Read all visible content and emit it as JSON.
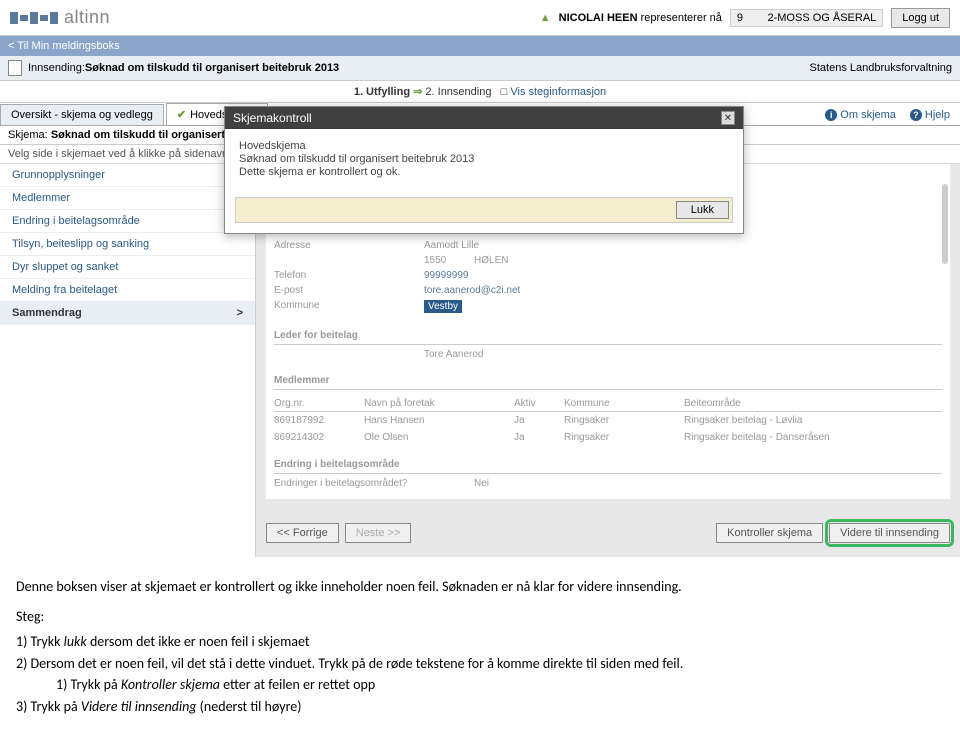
{
  "header": {
    "brand": "altinn",
    "user_name": "NICOLAI HEEN",
    "represents_label": "representerer nå",
    "org_id": "9",
    "org_suffix": "2-MOSS OG ÅSERAL",
    "logout": "Logg ut"
  },
  "breadcrumb": {
    "back": "< Til Min meldingsboks"
  },
  "titlebar": {
    "prefix": "Innsending:",
    "title": "Søknad om tilskudd til organisert beitebruk 2013",
    "owner": "Statens Landbruksforvaltning"
  },
  "steps": {
    "s1": "1. Utfylling",
    "s2": "2. Innsending",
    "info": "Vis steginformasjon",
    "sq": "□"
  },
  "tabs": {
    "overview": "Oversikt - skjema og vedlegg",
    "main": "Hovedskjema"
  },
  "skjema_title": {
    "label": "Skjema:",
    "name": "Søknad om tilskudd til organisert beitebr"
  },
  "help_row": {
    "om": "Om skjema",
    "hjelp": "Hjelp"
  },
  "subtext": "Velg side i skjemaet ved å klikke på sidenavn und",
  "sidebar": {
    "items": [
      "Grunnopplysninger",
      "Medlemmer",
      "Endring i beitelagsområde",
      "Tilsyn, beiteslipp og sanking",
      "Dyr sluppet og sanket",
      "Melding fra beitelaget",
      "Sammendrag"
    ],
    "arrow": ">"
  },
  "form": {
    "adresse_label": "Adresse",
    "adresse_val": "Aamodt Lille",
    "post_nr": "1550",
    "post_sted": "HØLEN",
    "telefon_label": "Telefon",
    "telefon_val": "99999999",
    "epost_label": "E-post",
    "epost_val": "tore.aanerod@c2i.net",
    "kommune_label": "Kommune",
    "kommune_val": "Vestby",
    "leder_label": "Leder for beitelag",
    "leder_val": "Tore  Aanerod"
  },
  "medlemmer": {
    "head": "Medlemmer",
    "cols": {
      "org": "Org.nr.",
      "navn": "Navn på foretak",
      "aktiv": "Aktiv",
      "kommune": "Kommune",
      "beite": "Beiteområde"
    },
    "rows": [
      {
        "org": "869187992",
        "navn": "Hans Hansen",
        "aktiv": "Ja",
        "kommune": "Ringsaker",
        "beite": "Ringsaker beitelag - Løvlia"
      },
      {
        "org": "869214302",
        "navn": "Ole Olsen",
        "aktiv": "Ja",
        "kommune": "Ringsaker",
        "beite": "Ringsaker beitelag - Danseråsen"
      }
    ]
  },
  "endring": {
    "head": "Endring i beitelagsområde",
    "q": "Endringer i beitelagsområdet?",
    "v": "Nei"
  },
  "buttons": {
    "prev": "<< Forrige",
    "next": "Neste >>",
    "kontroller": "Kontroller skjema",
    "videre": "Videre til innsending"
  },
  "modal": {
    "title": "Skjemakontroll",
    "line1": "Hovedskjema",
    "line2": "Søknad om tilskudd til organisert beitebruk 2013",
    "line3": "Dette skjema er kontrollert og ok.",
    "lukk": "Lukk"
  },
  "instructions": {
    "p1": "Denne boksen viser at skjemaet er kontrollert og ikke inneholder noen feil. Søknaden er nå klar for videre innsending.",
    "steg": "Steg:",
    "i1_pre": "1)   Trykk ",
    "i1_it": "lukk",
    "i1_post": " dersom det ikke er noen feil i skjemaet",
    "i2": "2)   Dersom det er noen feil, vil det stå i dette vinduet. Trykk på de røde tekstene for å komme direkte til siden med feil.",
    "i2a_pre": "1)   Trykk på ",
    "i2a_it": "Kontroller skjema",
    "i2a_post": " etter at feilen er rettet opp",
    "i3_pre": "3)   Trykk på ",
    "i3_it": "Videre til innsending",
    "i3_post": " (nederst til høyre)"
  }
}
